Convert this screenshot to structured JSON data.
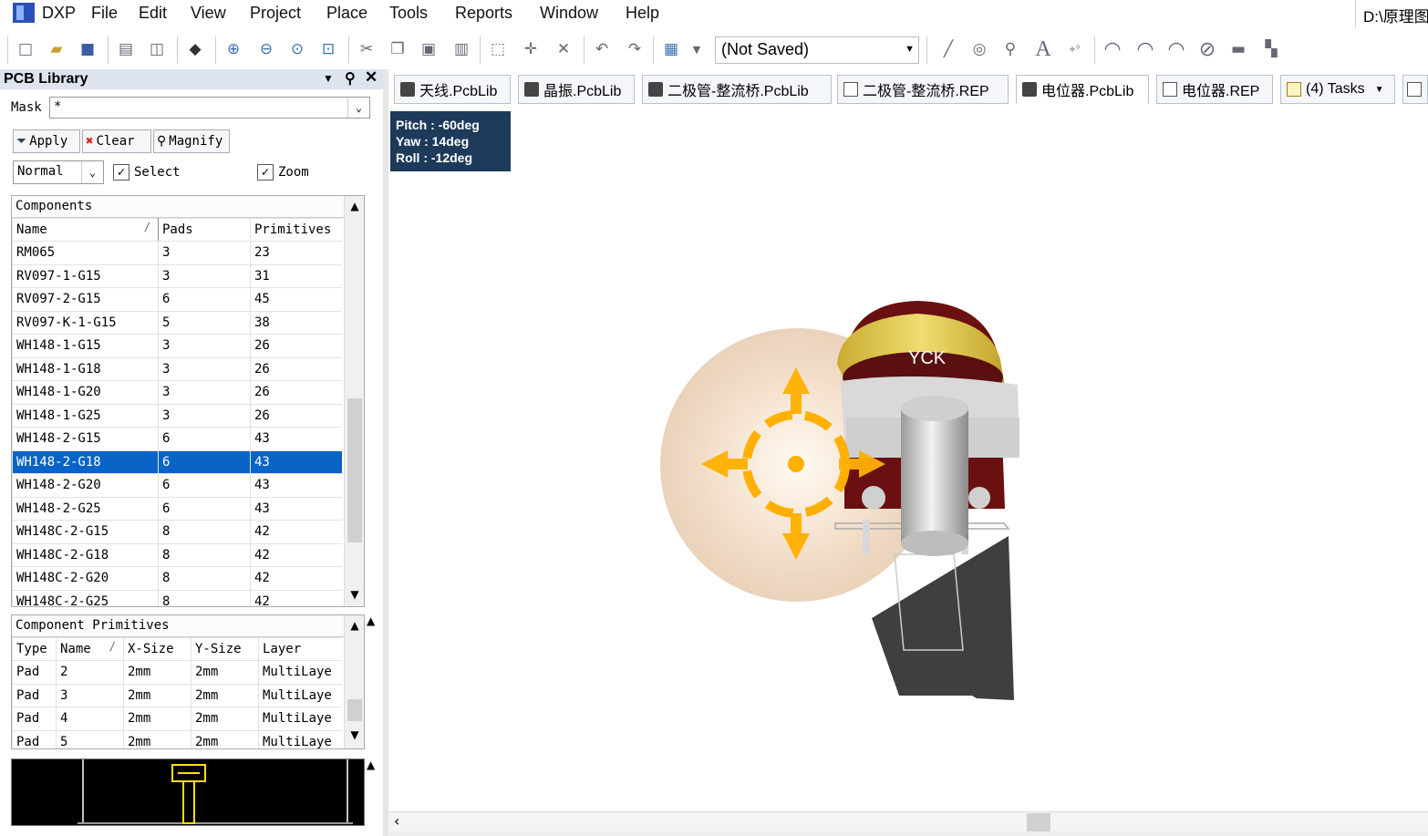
{
  "menubar": {
    "app_label": "DXP",
    "items": [
      "File",
      "Edit",
      "View",
      "Project",
      "Place",
      "Tools",
      "Reports",
      "Window",
      "Help"
    ],
    "path_text": "D:\\原理图"
  },
  "toolbar": {
    "doc_combo_value": "(Not Saved)"
  },
  "panel": {
    "title": "PCB Library",
    "mask_label": "Mask",
    "mask_value": "*",
    "apply_label": "Apply",
    "clear_label": "Clear",
    "magnify_label": "Magnify",
    "mode_value": "Normal",
    "select_label": "Select",
    "zoom_label": "Zoom",
    "select_checked": true,
    "zoom_checked": true
  },
  "components": {
    "section_title": "Components",
    "headers": [
      "Name",
      "Pads",
      "Primitives"
    ],
    "sort_glyph": "/",
    "rows": [
      [
        "RM065",
        "3",
        "23"
      ],
      [
        "RV097-1-G15",
        "3",
        "31"
      ],
      [
        "RV097-2-G15",
        "6",
        "45"
      ],
      [
        "RV097-K-1-G15",
        "5",
        "38"
      ],
      [
        "WH148-1-G15",
        "3",
        "26"
      ],
      [
        "WH148-1-G18",
        "3",
        "26"
      ],
      [
        "WH148-1-G20",
        "3",
        "26"
      ],
      [
        "WH148-1-G25",
        "3",
        "26"
      ],
      [
        "WH148-2-G15",
        "6",
        "43"
      ],
      [
        "WH148-2-G18",
        "6",
        "43"
      ],
      [
        "WH148-2-G20",
        "6",
        "43"
      ],
      [
        "WH148-2-G25",
        "6",
        "43"
      ],
      [
        "WH148C-2-G15",
        "8",
        "42"
      ],
      [
        "WH148C-2-G18",
        "8",
        "42"
      ],
      [
        "WH148C-2-G20",
        "8",
        "42"
      ],
      [
        "WH148C-2-G25",
        "8",
        "42"
      ]
    ],
    "selected_index": 9
  },
  "primitives": {
    "section_title": "Component Primitives",
    "headers": [
      "Type",
      "Name",
      "X-Size",
      "Y-Size",
      "Layer"
    ],
    "rows": [
      [
        "Pad",
        "2",
        "2mm",
        "2mm",
        "MultiLaye"
      ],
      [
        "Pad",
        "3",
        "2mm",
        "2mm",
        "MultiLaye"
      ],
      [
        "Pad",
        "4",
        "2mm",
        "2mm",
        "MultiLaye"
      ],
      [
        "Pad",
        "5",
        "2mm",
        "2mm",
        "MultiLaye"
      ]
    ]
  },
  "tabs": [
    {
      "label": "天线.PcbLib",
      "icon": "pcb-lib-icon"
    },
    {
      "label": "晶振.PcbLib",
      "icon": "pcb-lib-icon"
    },
    {
      "label": "二极管-整流桥.PcbLib",
      "icon": "pcb-lib-icon"
    },
    {
      "label": "二极管-整流桥.REP",
      "icon": "document-icon"
    },
    {
      "label": "电位器.PcbLib",
      "icon": "pcb-lib-icon"
    },
    {
      "label": "电位器.REP",
      "icon": "document-icon"
    },
    {
      "label": "(4) Tasks",
      "icon": "tasks-icon"
    }
  ],
  "hud": {
    "pitch": "Pitch : -60deg",
    "yaw": "Yaw : 14deg",
    "roll": "Roll : -12deg"
  },
  "model": {
    "brand_text": "YCK"
  },
  "colors": {
    "selection": "#0a64c8",
    "hud_bg": "#1e3a5a",
    "knob_gold": "#e2c84a",
    "body_maroon": "#6a1010",
    "navigator_orange": "#ffb000"
  }
}
